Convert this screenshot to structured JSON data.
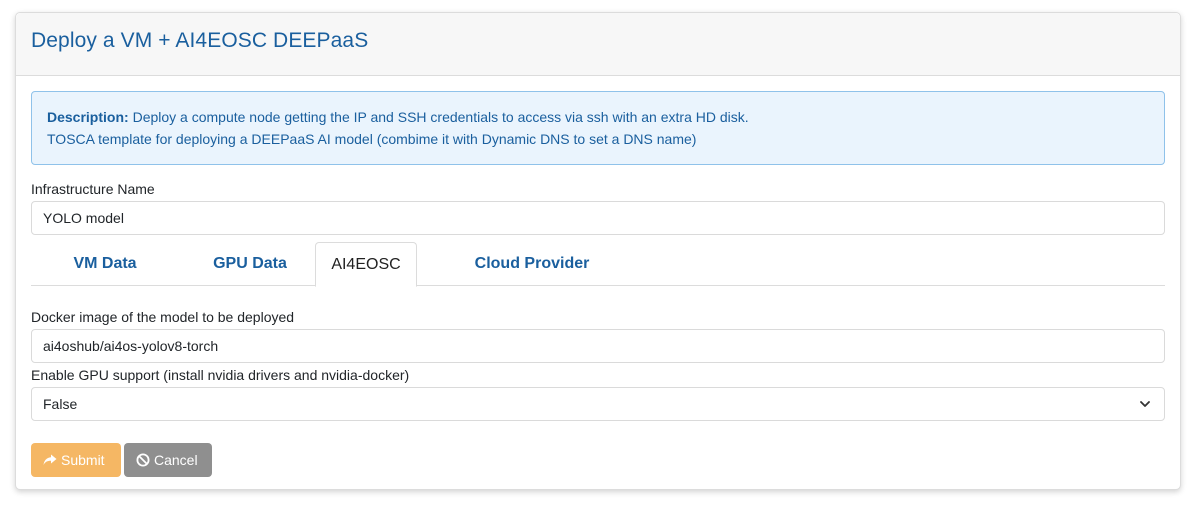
{
  "header": {
    "title": "Deploy a VM + AI4EOSC DEEPaaS"
  },
  "description": {
    "label": "Description:",
    "line1": " Deploy a compute node getting the IP and SSH credentials to access via ssh with an extra HD disk.",
    "line2": "TOSCA template for deploying a DEEPaaS AI model (combime it with Dynamic DNS to set a DNS name)"
  },
  "infra": {
    "label": "Infrastructure Name",
    "value": "YOLO model"
  },
  "tabs": [
    {
      "label": "VM Data",
      "active": false
    },
    {
      "label": "GPU Data",
      "active": false
    },
    {
      "label": "AI4EOSC",
      "active": true
    },
    {
      "label": "Cloud Provider",
      "active": false
    }
  ],
  "docker": {
    "label": "Docker image of the model to be deployed",
    "value": "ai4oshub/ai4os-yolov8-torch"
  },
  "gpu": {
    "label": "Enable GPU support (install nvidia drivers and nvidia-docker)",
    "selected": "False"
  },
  "buttons": {
    "submit_label": "Submit",
    "submit_icon": "share-arrow-icon",
    "cancel_label": "Cancel",
    "cancel_icon": "ban-icon"
  },
  "colors": {
    "link_blue": "#1a5f9e",
    "submit": "#f5b764",
    "cancel": "#8f8f8f",
    "alert_bg": "#eaf4fd"
  }
}
